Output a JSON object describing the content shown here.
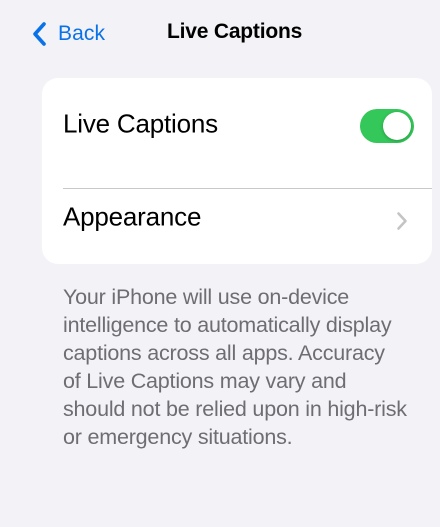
{
  "nav": {
    "back_label": "Back",
    "title": "Live Captions"
  },
  "settings": {
    "rows": [
      {
        "label": "Live Captions",
        "control": "toggle",
        "toggle_on": true
      },
      {
        "label": "Appearance",
        "control": "chevron-right-icon"
      }
    ]
  },
  "footer": {
    "description": "Your iPhone will use on-device intelligence to automatically display captions across all apps. Accuracy of Live Captions may vary and should not be relied upon in high-risk or emergency situations."
  },
  "colors": {
    "background": "#f2f2f7",
    "card": "#ffffff",
    "accent_blue": "#0a72e8",
    "toggle_on": "#34c759",
    "footer_text": "#6d6d72",
    "chevron": "#c4c4c7"
  },
  "icons": {
    "back": "chevron-left-icon",
    "row_disclosure": "chevron-right-icon"
  }
}
